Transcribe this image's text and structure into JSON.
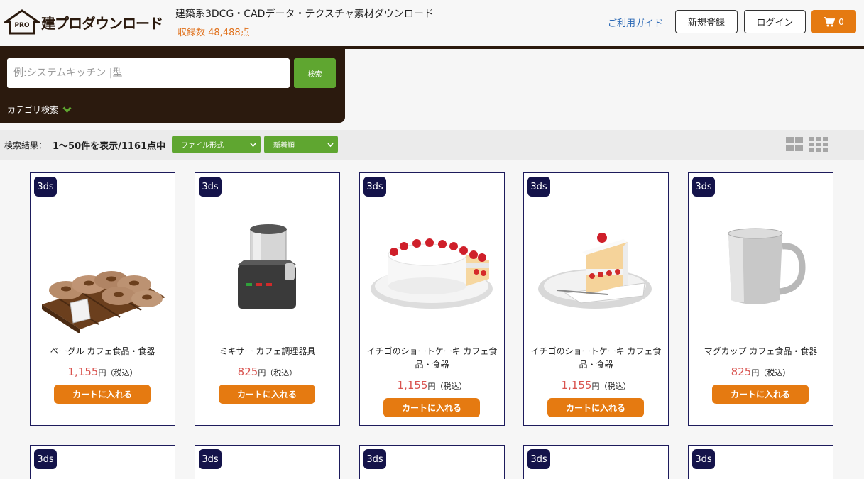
{
  "header": {
    "logo_badge": "PRO",
    "logo_text": "建プロダウンロード",
    "tagline": "建築系3DCG・CADデータ・テクスチャ素材ダウンロード",
    "count": "収録数 48,488点",
    "guide_link": "ご利用ガイド",
    "register_label": "新規登録",
    "login_label": "ログイン",
    "cart_count": "0"
  },
  "search": {
    "placeholder": "例:システムキッチン |型",
    "button_label": "検索",
    "category_label": "カテゴリ検索"
  },
  "results": {
    "label": "検索結果：",
    "range": "1〜50件を表示/1161点中",
    "format_select": "ファイル形式",
    "sort_select": "新着順"
  },
  "colors": {
    "brand_dark": "#2b1a0e",
    "accent_green": "#5fa630",
    "accent_orange": "#e57a11",
    "price_red": "#d9534f"
  },
  "products": [
    {
      "badge": "3ds",
      "name": "ベーグル カフェ食品・食器",
      "price": "1,155",
      "yen": "円（税込）",
      "cart": "カートに入れる",
      "image": "bagel-tray-icon"
    },
    {
      "badge": "3ds",
      "name": "ミキサー カフェ調理器具",
      "price": "825",
      "yen": "円（税込）",
      "cart": "カートに入れる",
      "image": "mixer-icon"
    },
    {
      "badge": "3ds",
      "name": "イチゴのショートケーキ カフェ食品・食器",
      "price": "1,155",
      "yen": "円（税込）",
      "cart": "カートに入れる",
      "image": "whole-cake-icon"
    },
    {
      "badge": "3ds",
      "name": "イチゴのショートケーキ カフェ食品・食器",
      "price": "1,155",
      "yen": "円（税込）",
      "cart": "カートに入れる",
      "image": "cake-slice-icon"
    },
    {
      "badge": "3ds",
      "name": "マグカップ カフェ食品・食器",
      "price": "825",
      "yen": "円（税込）",
      "cart": "カートに入れる",
      "image": "mug-icon"
    }
  ],
  "next_row": [
    {
      "badge": "3ds"
    },
    {
      "badge": "3ds"
    },
    {
      "badge": "3ds"
    },
    {
      "badge": "3ds"
    },
    {
      "badge": "3ds"
    }
  ]
}
